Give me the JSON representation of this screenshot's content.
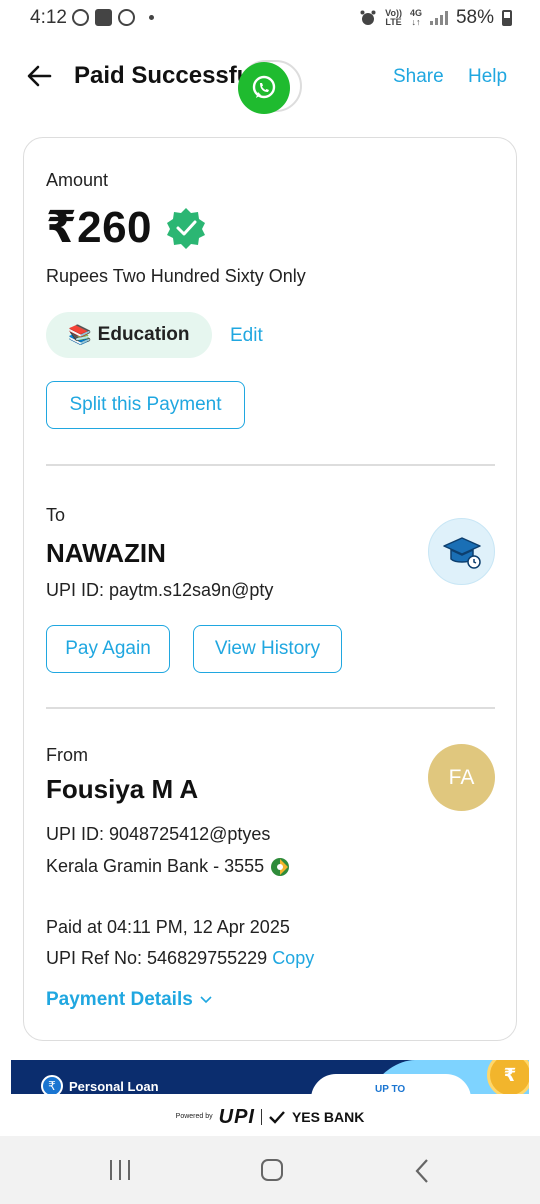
{
  "status_bar": {
    "time": "4:12",
    "volte_top": "Vo))",
    "volte_bottom": "LTE",
    "net_top": "4G",
    "net_bottom": "↓↑",
    "battery": "58%"
  },
  "header": {
    "title": "Paid Successfully",
    "share_label": "Share",
    "help_label": "Help"
  },
  "amount_section": {
    "label": "Amount",
    "amount": "₹260",
    "amount_words": "Rupees Two Hundred Sixty Only",
    "category_emoji": "📚",
    "category": "Education",
    "edit_label": "Edit",
    "split_label": "Split this Payment"
  },
  "to_section": {
    "label": "To",
    "name": "NAWAZIN",
    "upi_id": "UPI ID: paytm.s12sa9n@pty",
    "pay_again_label": "Pay Again",
    "view_history_label": "View History"
  },
  "from_section": {
    "label": "From",
    "name": "Fousiya M A",
    "avatar_initials": "FA",
    "upi_id": "UPI ID: 9048725412@ptyes",
    "bank": "Kerala Gramin Bank - 3555",
    "paid_at": "Paid at 04:11 PM, 12 Apr 2025",
    "ref_no": "UPI Ref No: 546829755229",
    "copy_label": "Copy",
    "details_label": "Payment Details"
  },
  "banner": {
    "title": "Personal Loan",
    "cta": "UP TO",
    "coin": "₹"
  },
  "footer": {
    "powered_by": "Powered by",
    "upi": "UPI",
    "bank": "YES BANK"
  },
  "colors": {
    "accent": "#20a7e0",
    "verified": "#2bb673",
    "whatsapp": "#1fbb2f",
    "chip_bg": "#e6f6ef",
    "avatar_fa": "#e0c77e",
    "banner_bg": "#0b2d6e"
  },
  "icons": [
    "back-arrow-icon",
    "whatsapp-icon",
    "verified-badge-icon",
    "education-cap-icon",
    "bank-logo-icon",
    "chevron-down-icon"
  ]
}
